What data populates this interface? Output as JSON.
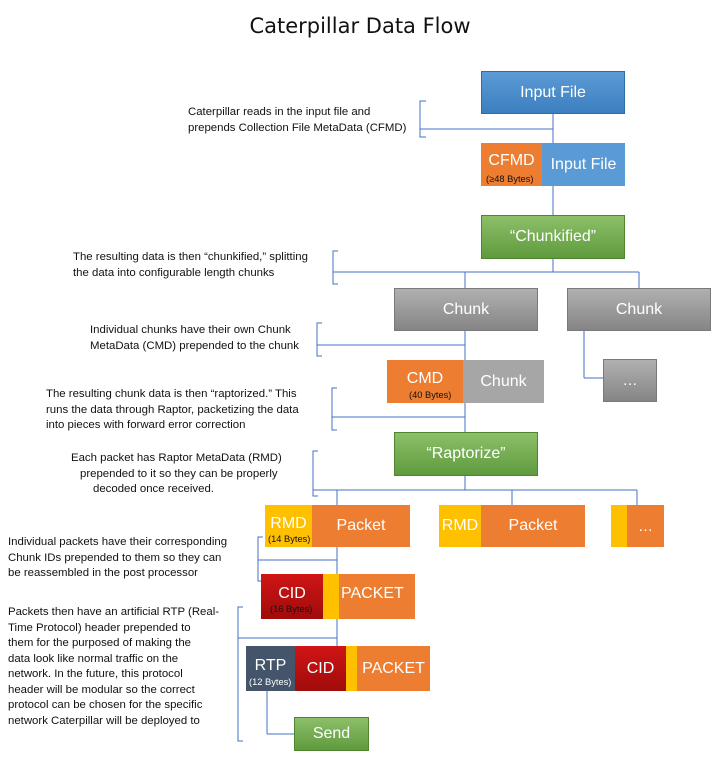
{
  "title": "Caterpillar Data Flow",
  "nodes": {
    "input_file": "Input File",
    "cfmd": "CFMD",
    "cfmd_size": "(≥48 Bytes)",
    "cfmd_input_file": "Input File",
    "chunkified": "“Chunkified”",
    "chunk_a": "Chunk",
    "chunk_b": "Chunk",
    "cmd": "CMD",
    "cmd_size": "(40 Bytes)",
    "cmd_chunk": "Chunk",
    "ellipsis_1": "…",
    "raptorize": "“Raptorize”",
    "rmd_1": "RMD",
    "rmd_size": "(14 Bytes)",
    "packet_1": "Packet",
    "rmd_2": "RMD",
    "packet_2": "Packet",
    "ellipsis_2": "…",
    "cid_1": "CID",
    "cid_size": "(16 Bytes)",
    "packet_cid": "PACKET",
    "rtp": "RTP",
    "rtp_size": "(12 Bytes)",
    "cid_2": "CID",
    "packet_rtp": "PACKET",
    "send": "Send"
  },
  "notes": {
    "read_input": [
      "Caterpillar reads in the input file and",
      "prepends Collection File MetaData (CFMD)"
    ],
    "chunkify": [
      "The resulting data is then “chunkified,” splitting",
      "the data into configurable length chunks"
    ],
    "chunk_meta": [
      "Individual chunks have their own Chunk",
      "MetaData (CMD) prepended to the chunk"
    ],
    "raptorize": [
      "The resulting chunk data is then “raptorized.” This",
      "runs the data through Raptor, packetizing the data",
      "into pieces with forward error correction"
    ],
    "rmd": [
      "Each packet has Raptor MetaData (RMD)",
      "prepended to it so they can be properly",
      "decoded once received."
    ],
    "cid": [
      "Individual packets have their corresponding",
      "Chunk IDs prepended to them so they can",
      "be reassembled in the post processor"
    ],
    "rtp": [
      "Packets then have an artificial RTP (Real-",
      "Time Protocol) header prepended to",
      "them for the purposed of making the",
      "data look like normal traffic on the",
      "network.  In the future, this protocol",
      "header will be modular so the correct",
      "protocol can be chosen for the specific",
      "network Caterpillar will be deployed to"
    ]
  },
  "colors": {
    "blue": "#5b9bd5",
    "green": "#70ad47",
    "gray": "#a6a6a6",
    "orange": "#ed7d31",
    "yellow": "#ffc000",
    "red": "#c00000",
    "navy": "#44546a",
    "connector": "#4472c4"
  }
}
